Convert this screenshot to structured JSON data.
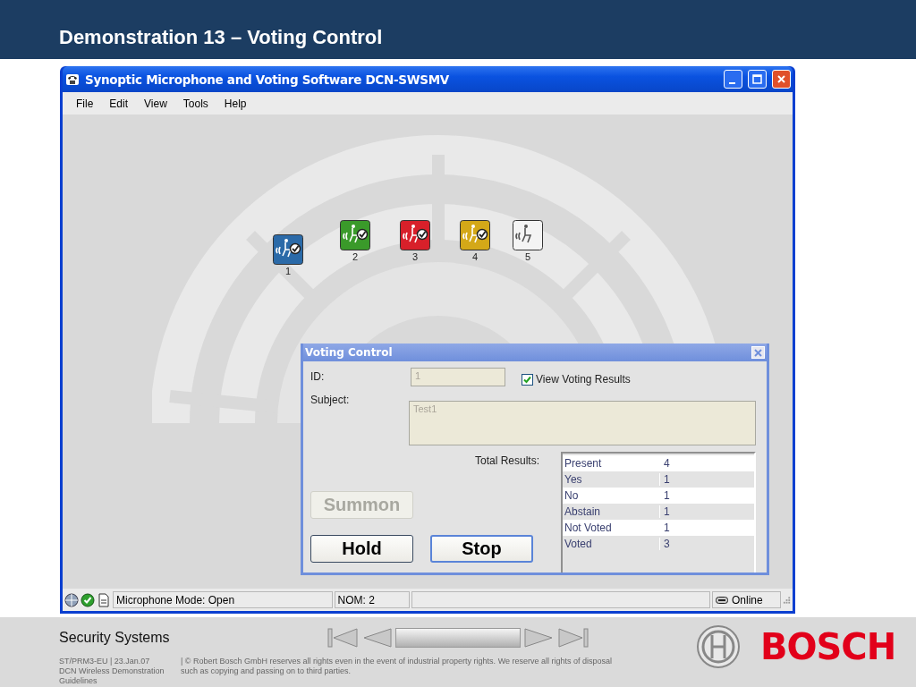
{
  "slide": {
    "title": "Demonstration 13 – Voting Control"
  },
  "window": {
    "title": "Synoptic Microphone and Voting Software DCN-SWSMV"
  },
  "menu": [
    "File",
    "Edit",
    "View",
    "Tools",
    "Help"
  ],
  "seats": [
    {
      "number": "1",
      "color": "#2b6aa8",
      "voted": true
    },
    {
      "number": "2",
      "color": "#3a9a2a",
      "voted": true
    },
    {
      "number": "3",
      "color": "#d8202a",
      "voted": true
    },
    {
      "number": "4",
      "color": "#d4a818",
      "voted": true
    },
    {
      "number": "5",
      "color": "#f4f4f4",
      "voted": false
    }
  ],
  "voting_dialog": {
    "title": "Voting Control",
    "id_label": "ID:",
    "id_value": "1",
    "view_results": {
      "label": "View Voting Results",
      "checked": true
    },
    "subject_label": "Subject:",
    "subject_value": "Test1",
    "total_results_label": "Total Results:",
    "results": [
      {
        "label": "Present",
        "value": "4"
      },
      {
        "label": "Yes",
        "value": "1"
      },
      {
        "label": "No",
        "value": "1"
      },
      {
        "label": "Abstain",
        "value": "1"
      },
      {
        "label": "Not Voted",
        "value": "1"
      },
      {
        "label": "Voted",
        "value": "3"
      }
    ],
    "buttons": [
      {
        "label": "Summon",
        "disabled": true,
        "focused": false
      },
      {
        "label": "Hold",
        "disabled": false,
        "focused": false
      },
      {
        "label": "Stop",
        "disabled": false,
        "focused": true
      }
    ]
  },
  "status_bar": {
    "mode": "Microphone Mode: Open",
    "nom": "NOM: 2",
    "connection": "Online"
  },
  "footer": {
    "section": "Security Systems",
    "doc_code": "ST/PRM3-EU  |  23.Jan.07",
    "doc_title": "DCN Wireless Demonstration Guidelines",
    "copyright": "| © Robert Bosch GmbH reserves all rights even in the event of industrial property rights. We reserve all rights of disposal such as copying and passing on to third parties.",
    "brand": "BOSCH"
  }
}
